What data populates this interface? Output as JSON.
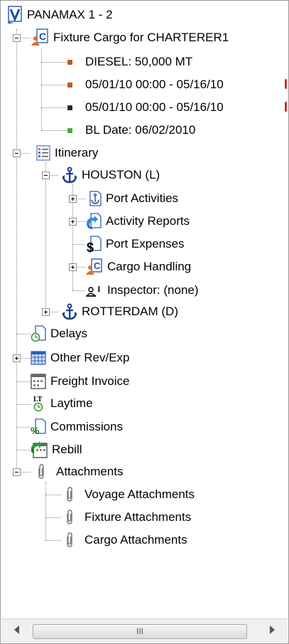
{
  "tree": {
    "root": {
      "label": "PANAMAX 1 - 2",
      "icon": "voyage-v-icon"
    },
    "fixture": {
      "label": "Fixture Cargo for CHARTERER1",
      "icon": "cargo-c-icon",
      "items": [
        {
          "label": "DIESEL: 50,000 MT",
          "dot_color": "#c05a1a"
        },
        {
          "label": "05/01/10  00:00 - 05/16/10",
          "dot_color": "#c05a1a"
        },
        {
          "label": "05/01/10  00:00 - 05/16/10",
          "dot_color": "#2a2a2a"
        },
        {
          "label": "BL Date: 06/02/2010",
          "dot_color": "#4aaa3a"
        }
      ]
    },
    "itinerary": {
      "label": "Itinerary",
      "icon": "list-icon",
      "ports": [
        {
          "label": "HOUSTON (L)",
          "icon": "anchor-icon",
          "children": [
            {
              "label": "Port Activities",
              "icon": "port-activities-icon"
            },
            {
              "label": "Activity Reports",
              "icon": "activity-reports-icon"
            },
            {
              "label": "Port Expenses",
              "icon": "dollar-doc-icon"
            },
            {
              "label": "Cargo Handling",
              "icon": "cargo-c-icon"
            },
            {
              "label": "Inspector: (none)",
              "icon": "inspector-icon"
            }
          ]
        },
        {
          "label": "ROTTERDAM (D)",
          "icon": "anchor-icon"
        }
      ]
    },
    "top_items": [
      {
        "label": "Delays",
        "icon": "clock-doc-icon"
      },
      {
        "label": "Other Rev/Exp",
        "icon": "grid-icon"
      },
      {
        "label": "Freight Invoice",
        "icon": "invoice-icon"
      },
      {
        "label": "Laytime",
        "icon": "laytime-icon"
      },
      {
        "label": "Commissions",
        "icon": "percent-doc-icon"
      },
      {
        "label": "Rebill",
        "icon": "rebill-icon"
      }
    ],
    "attachments": {
      "label": "Attachments",
      "icon": "paperclip-icon",
      "items": [
        {
          "label": "Voyage Attachments"
        },
        {
          "label": "Fixture Attachments"
        },
        {
          "label": "Cargo Attachments"
        }
      ]
    }
  },
  "scrollbar": {
    "thumb_grip": "III"
  }
}
